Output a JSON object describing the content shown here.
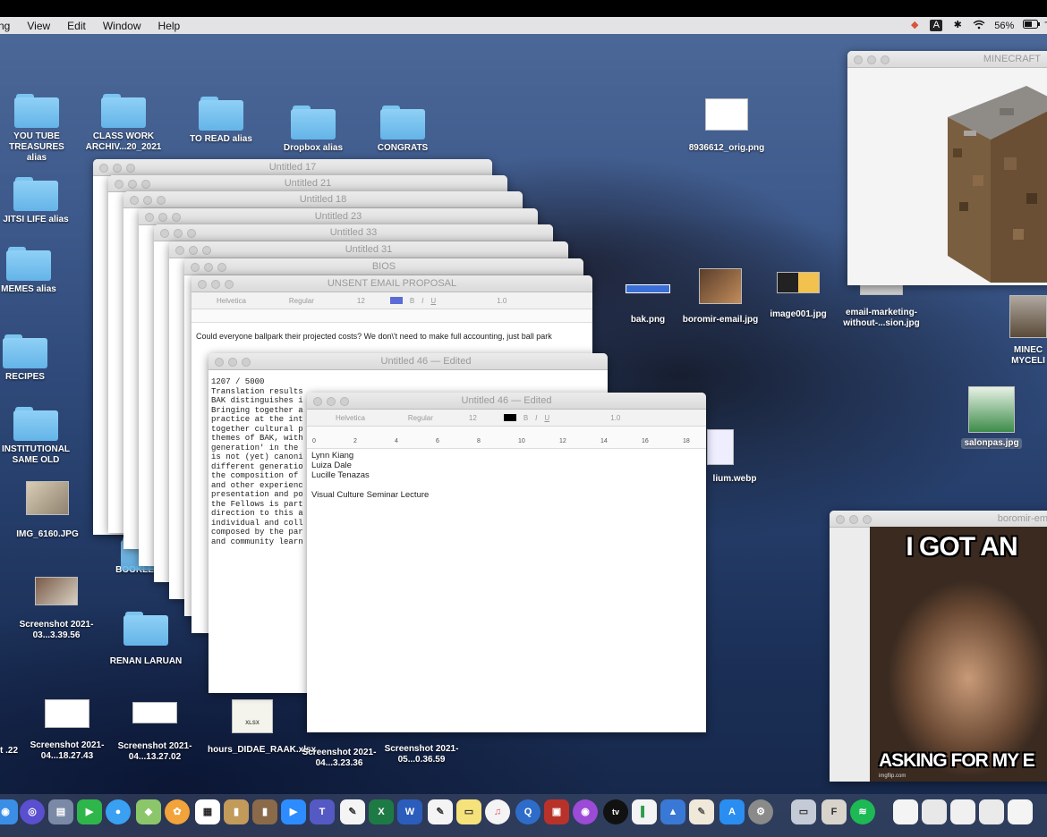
{
  "menubar": {
    "items": [
      "ng",
      "View",
      "Edit",
      "Window",
      "Help"
    ],
    "battery": "56%",
    "input_source": "A",
    "status_end": "T"
  },
  "desktop_icons": [
    {
      "label": "YOU TUBE TREASURES alias"
    },
    {
      "label": "CLASS WORK ARCHIV...20_2021"
    },
    {
      "label": "TO READ alias"
    },
    {
      "label": "Dropbox alias"
    },
    {
      "label": "CONGRATS"
    },
    {
      "label": "JITSI LIFE alias"
    },
    {
      "label": "MEMES alias"
    },
    {
      "label": "RECIPES"
    },
    {
      "label": "INSTITUTIONAL SAME OLD"
    },
    {
      "label": "IMG_6160.JPG"
    },
    {
      "label": "Screenshot 2021-03...3.39.56"
    },
    {
      "label": "BOOKLETTE"
    },
    {
      "label": "RENAN LARUAN"
    },
    {
      "label": "Screenshot 2021-04...18.27.43"
    },
    {
      "label": "Screenshot 2021-04...13.27.02"
    },
    {
      "label": "hours_DIDAE_RAAK.xlsx"
    },
    {
      "label": "Screenshot 2021-04...3.23.36"
    },
    {
      "label": "Screenshot 2021-05...0.36.59"
    },
    {
      "label": "8936612_orig.png"
    },
    {
      "label": "bak.png"
    },
    {
      "label": "boromir-email.jpg"
    },
    {
      "label": "image001.jpg"
    },
    {
      "label": "email-marketing-without-...sion.jpg"
    },
    {
      "label": "salonpas.jpg"
    },
    {
      "label": "lium.webp"
    },
    {
      "label": "MINEC MYCELI"
    },
    {
      "label": "t .22"
    }
  ],
  "stack_windows": [
    {
      "title": "Untitled 17"
    },
    {
      "title": "Untitled 21"
    },
    {
      "title": "Untitled 18"
    },
    {
      "title": "Untitled 23"
    },
    {
      "title": "Untitled 33"
    },
    {
      "title": "Untitled 31"
    },
    {
      "title": "BIOS"
    },
    {
      "title": "UNSENT EMAIL PROPOSAL"
    }
  ],
  "proposal_window": {
    "font": "Helvetica",
    "style": "Regular",
    "size": "12",
    "spacing": "1.0",
    "text": "Could everyone ballpark their projected costs? We don\\'t need to make full accounting, just ball park"
  },
  "translation_window": {
    "title": "Untitled 46 — Edited",
    "counter": "1207 / 5000",
    "heading": "Translation results",
    "lines": [
      "BAK distinguishes i",
      "Bringing together a",
      "practice at the int",
      "together cultural p",
      "themes of BAK, with",
      "generation' in the",
      "is not (yet) canoni",
      "different generatio",
      "the composition of",
      "and other experienc",
      "presentation and po",
      "the Fellows is part",
      "direction to this a",
      "individual and coll",
      "composed by the par",
      "and community learn"
    ]
  },
  "front_window": {
    "title": "Untitled 46 — Edited",
    "font": "Helvetica",
    "style": "Regular",
    "size": "12",
    "spacing": "1.0",
    "ruler_marks": [
      "0",
      "2",
      "4",
      "6",
      "8",
      "10",
      "12",
      "14",
      "16",
      "18"
    ],
    "lines": [
      "Lynn Kiang",
      "Luiza Dale",
      "Lucille Tenazas",
      "",
      "Visual Culture Seminar Lecture"
    ]
  },
  "minecraft_window": {
    "title": "MINECRAFT"
  },
  "meme_window": {
    "title": "boromir-em",
    "caption_top": "I GOT AN",
    "caption_bottom": "ASKING FOR MY E",
    "watermark": "imgflip.com"
  },
  "colors": {
    "accent": "#5b6bd6",
    "folder": "#7cc4f0",
    "menubar": "#e3e3e6"
  }
}
